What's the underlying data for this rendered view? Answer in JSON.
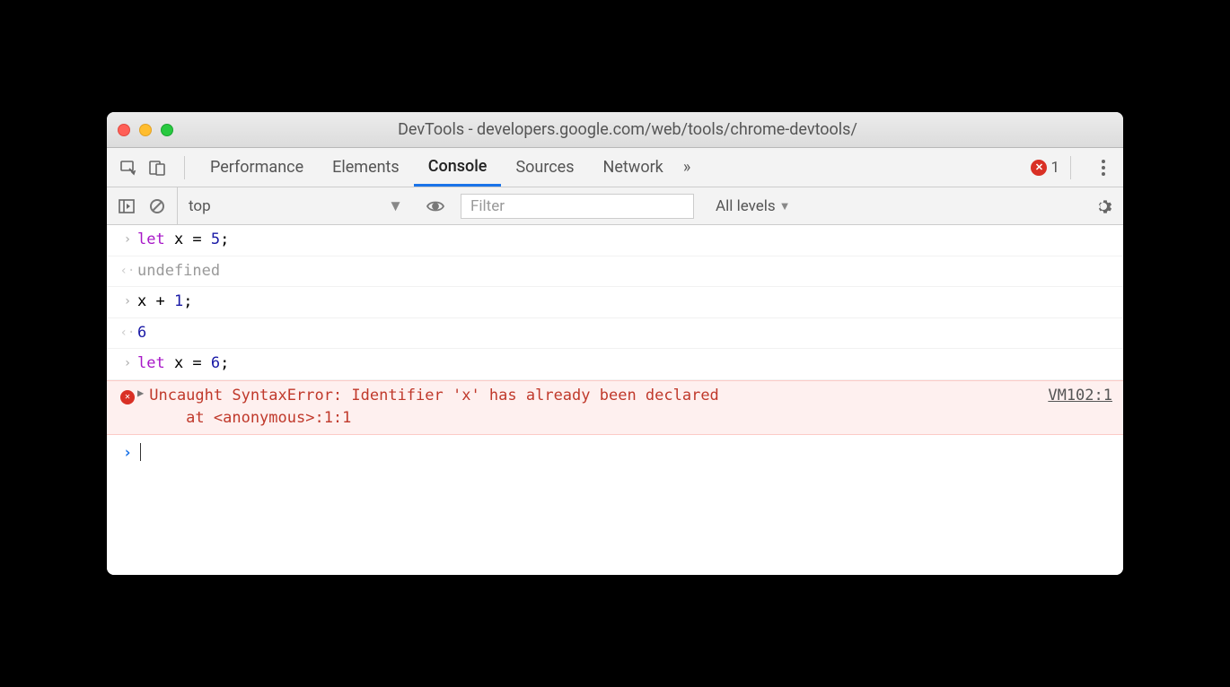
{
  "window": {
    "title": "DevTools - developers.google.com/web/tools/chrome-devtools/"
  },
  "tabs": {
    "items": [
      "Performance",
      "Elements",
      "Console",
      "Sources",
      "Network"
    ],
    "active": "Console",
    "error_count": "1"
  },
  "toolbar": {
    "context": "top",
    "filter_placeholder": "Filter",
    "levels": "All levels"
  },
  "console": {
    "rows": [
      {
        "type": "input",
        "raw": "let x = 5;",
        "html": "<span class=\"kw\">let</span> x = <span class=\"num\">5</span>;"
      },
      {
        "type": "output",
        "raw": "undefined",
        "html": "<span class=\"undef\">undefined</span>"
      },
      {
        "type": "input",
        "raw": "x + 1;",
        "html": "x + <span class=\"num\">1</span>;"
      },
      {
        "type": "output",
        "raw": "6",
        "html": "<span class=\"num\">6</span>"
      },
      {
        "type": "input",
        "raw": "let x = 6;",
        "html": "<span class=\"kw\">let</span> x = <span class=\"num\">6</span>;"
      }
    ],
    "error": {
      "message": "Uncaught SyntaxError: Identifier 'x' has already been declared",
      "stack": "    at <anonymous>:1:1",
      "source": "VM102:1"
    }
  }
}
